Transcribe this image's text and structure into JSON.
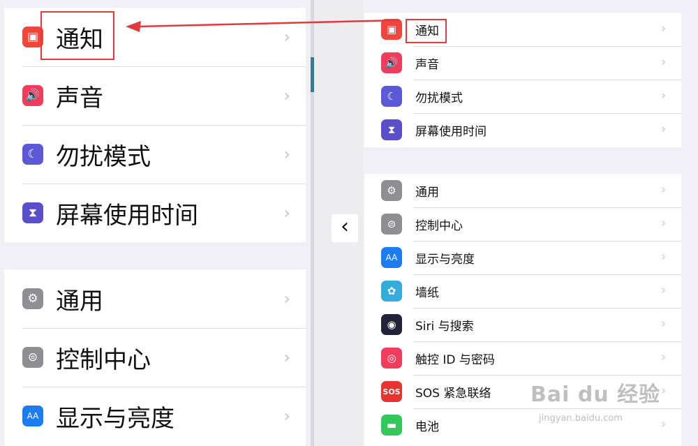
{
  "left_panel": {
    "group1": [
      {
        "label": "通知",
        "icon": "notifications-icon",
        "color": "#f0463c",
        "glyph": "▣"
      },
      {
        "label": "声音",
        "icon": "sounds-icon",
        "color": "#f23c5c",
        "glyph": "🔊"
      },
      {
        "label": "勿扰模式",
        "icon": "do-not-disturb-icon",
        "color": "#5b59d6",
        "glyph": "☾"
      },
      {
        "label": "屏幕使用时间",
        "icon": "screen-time-icon",
        "color": "#5b4fc9",
        "glyph": "⧗"
      }
    ],
    "group2": [
      {
        "label": "通用",
        "icon": "gear-icon",
        "color": "#8e8e93",
        "glyph": "⚙"
      },
      {
        "label": "控制中心",
        "icon": "control-center-icon",
        "color": "#8e8e93",
        "glyph": "⊜"
      },
      {
        "label": "显示与亮度",
        "icon": "display-brightness-icon",
        "color": "#1e7cf2",
        "glyph": "AA"
      }
    ]
  },
  "right_panel": {
    "group1": [
      {
        "label": "通知",
        "icon": "notifications-icon",
        "color": "#f0463c",
        "glyph": "▣"
      },
      {
        "label": "声音",
        "icon": "sounds-icon",
        "color": "#f23c5c",
        "glyph": "🔊"
      },
      {
        "label": "勿扰模式",
        "icon": "do-not-disturb-icon",
        "color": "#5b59d6",
        "glyph": "☾"
      },
      {
        "label": "屏幕使用时间",
        "icon": "screen-time-icon",
        "color": "#5b4fc9",
        "glyph": "⧗"
      }
    ],
    "group2": [
      {
        "label": "通用",
        "icon": "gear-icon",
        "color": "#8e8e93",
        "glyph": "⚙"
      },
      {
        "label": "控制中心",
        "icon": "control-center-icon",
        "color": "#8e8e93",
        "glyph": "⊜"
      },
      {
        "label": "显示与亮度",
        "icon": "display-brightness-icon",
        "color": "#1e7cf2",
        "glyph": "AA"
      },
      {
        "label": "墙纸",
        "icon": "wallpaper-icon",
        "color": "#35aadc",
        "glyph": "✿"
      },
      {
        "label": "Siri 与搜索",
        "icon": "siri-icon",
        "color": "#222238",
        "glyph": "◉"
      },
      {
        "label": "触控 ID 与密码",
        "icon": "touch-id-icon",
        "color": "#f23c5c",
        "glyph": "◎"
      },
      {
        "label": "SOS 紧急联络",
        "icon": "sos-icon",
        "color": "#e5352e",
        "glyph": "SOS"
      },
      {
        "label": "电池",
        "icon": "battery-icon",
        "color": "#34c759",
        "glyph": "▬"
      }
    ]
  },
  "chevron": "›",
  "back_glyph": "‹",
  "colors": {
    "highlight": "#e4393c",
    "arrow": "#e4393c"
  },
  "watermark": {
    "brand": "Bai du 经验",
    "url": "jingyan.baidu.com"
  }
}
